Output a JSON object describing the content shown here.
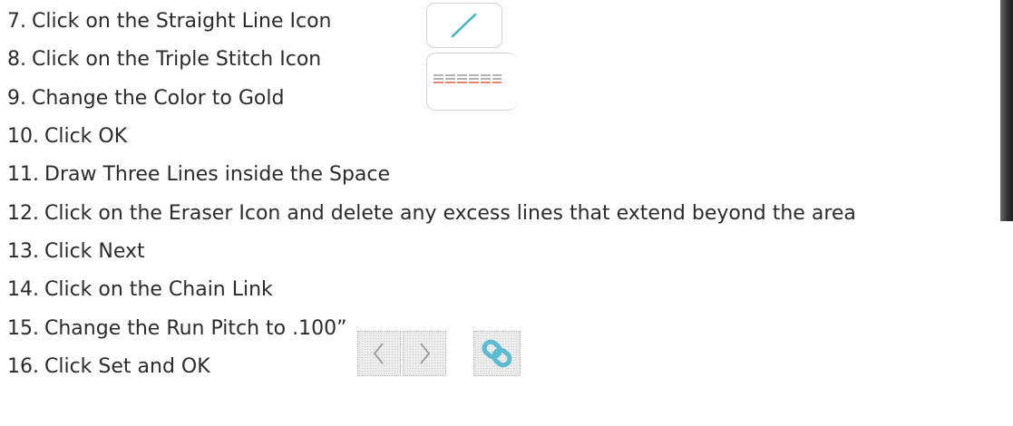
{
  "steps": [
    {
      "num": "7.",
      "text": "Click on the Straight Line Icon"
    },
    {
      "num": "8.",
      "text": "Click on the Triple Stitch Icon"
    },
    {
      "num": "9.",
      "text": "Change the Color to Gold"
    },
    {
      "num": "10.",
      "text": "Click OK"
    },
    {
      "num": "11.",
      "text": "Draw Three Lines inside the Space"
    },
    {
      "num": "12.",
      "text": "Click on the Eraser Icon and delete any excess lines that extend beyond the area"
    },
    {
      "num": "13.",
      "text": "Click Next"
    },
    {
      "num": "14.",
      "text": "Click on the Chain Link"
    },
    {
      "num": "15.",
      "text": "Change the Run Pitch to .100”"
    },
    {
      "num": "16.",
      "text": "Click Set and OK"
    }
  ],
  "colors": {
    "text": "#2b2b2b",
    "line_icon": "#3ab3c8",
    "stitch_top": "#9a9a9a",
    "stitch_red": "#e25a3c",
    "chain_link": "#5bbcd4"
  },
  "icons": {
    "straight_line": "straight-line-icon",
    "triple_stitch": "triple-stitch-icon",
    "prev": "chevron-left-icon",
    "next": "chevron-right-icon",
    "chain": "chain-link-icon"
  }
}
